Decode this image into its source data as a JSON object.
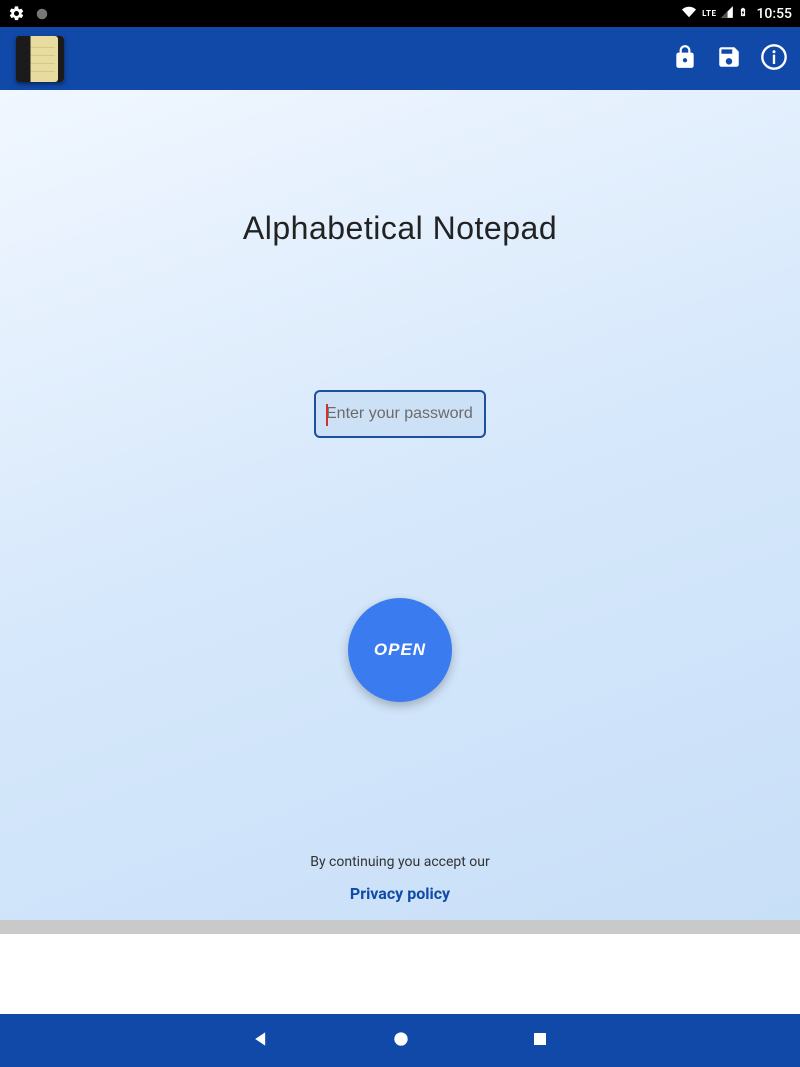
{
  "status_bar": {
    "lte": "LTE",
    "time": "10:55"
  },
  "main": {
    "title": "Alphabetical Notepad",
    "password_placeholder": "Enter your password",
    "password_value": "",
    "open_label": "OPEN",
    "accept_text": "By continuing you accept our",
    "privacy_label": "Privacy policy"
  }
}
